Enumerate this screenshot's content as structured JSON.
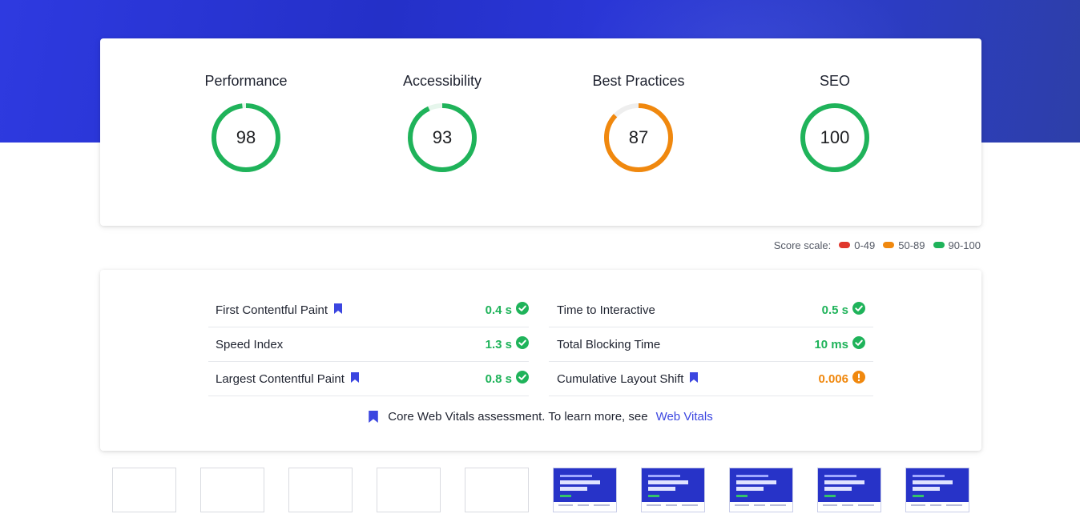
{
  "colors": {
    "pass": "#1fb35a",
    "average": "#f0880e",
    "fail": "#e0362c",
    "accent": "#3b46e0"
  },
  "scores": [
    {
      "title": "Performance",
      "value": 98,
      "status": "pass"
    },
    {
      "title": "Accessibility",
      "value": 93,
      "status": "pass"
    },
    {
      "title": "Best Practices",
      "value": 87,
      "status": "average"
    },
    {
      "title": "SEO",
      "value": 100,
      "status": "pass"
    }
  ],
  "score_scale": {
    "label": "Score scale:",
    "ranges": [
      {
        "label": "0-49",
        "status": "fail"
      },
      {
        "label": "50-89",
        "status": "average"
      },
      {
        "label": "90-100",
        "status": "pass"
      }
    ]
  },
  "metrics": [
    {
      "label": "First Contentful Paint",
      "value": "0.4 s",
      "core": true,
      "status": "pass",
      "status_icon": "check-circle-icon"
    },
    {
      "label": "Time to Interactive",
      "value": "0.5 s",
      "core": false,
      "status": "pass",
      "status_icon": "check-circle-icon"
    },
    {
      "label": "Speed Index",
      "value": "1.3 s",
      "core": false,
      "status": "pass",
      "status_icon": "check-circle-icon"
    },
    {
      "label": "Total Blocking Time",
      "value": "10 ms",
      "core": false,
      "status": "pass",
      "status_icon": "check-circle-icon"
    },
    {
      "label": "Largest Contentful Paint",
      "value": "0.8 s",
      "core": true,
      "status": "pass",
      "status_icon": "check-circle-icon"
    },
    {
      "label": "Cumulative Layout Shift",
      "value": "0.006",
      "core": true,
      "status": "average",
      "status_icon": "warning-circle-icon"
    }
  ],
  "cwv_note": {
    "text": "Core Web Vitals assessment. To learn more, see",
    "link": "Web Vitals"
  },
  "filmstrip": {
    "frames": [
      false,
      false,
      false,
      false,
      false,
      true,
      true,
      true,
      true,
      true
    ]
  }
}
